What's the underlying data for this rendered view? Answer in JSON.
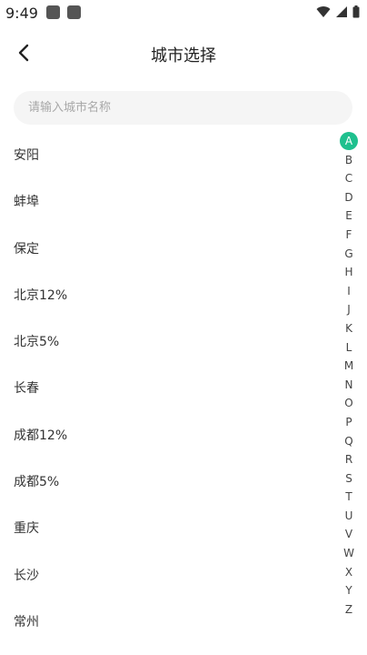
{
  "status_bar": {
    "time": "9:49",
    "icons": [
      "app-notification-icon",
      "app-notification-icon",
      "wifi-icon",
      "signal-icon",
      "battery-icon"
    ]
  },
  "header": {
    "title": "城市选择",
    "back_icon": "chevron-left-icon"
  },
  "search": {
    "placeholder": "请输入城市名称",
    "value": ""
  },
  "cities": [
    "安阳",
    "蚌埠",
    "保定",
    "北京12%",
    "北京5%",
    "长春",
    "成都12%",
    "成都5%",
    "重庆",
    "长沙",
    "常州"
  ],
  "index_bar": {
    "letters": [
      "A",
      "B",
      "C",
      "D",
      "E",
      "F",
      "G",
      "H",
      "I",
      "J",
      "K",
      "L",
      "M",
      "N",
      "O",
      "P",
      "Q",
      "R",
      "S",
      "T",
      "U",
      "V",
      "W",
      "X",
      "Y",
      "Z"
    ],
    "active": "A",
    "active_color": "#1fc08e"
  }
}
